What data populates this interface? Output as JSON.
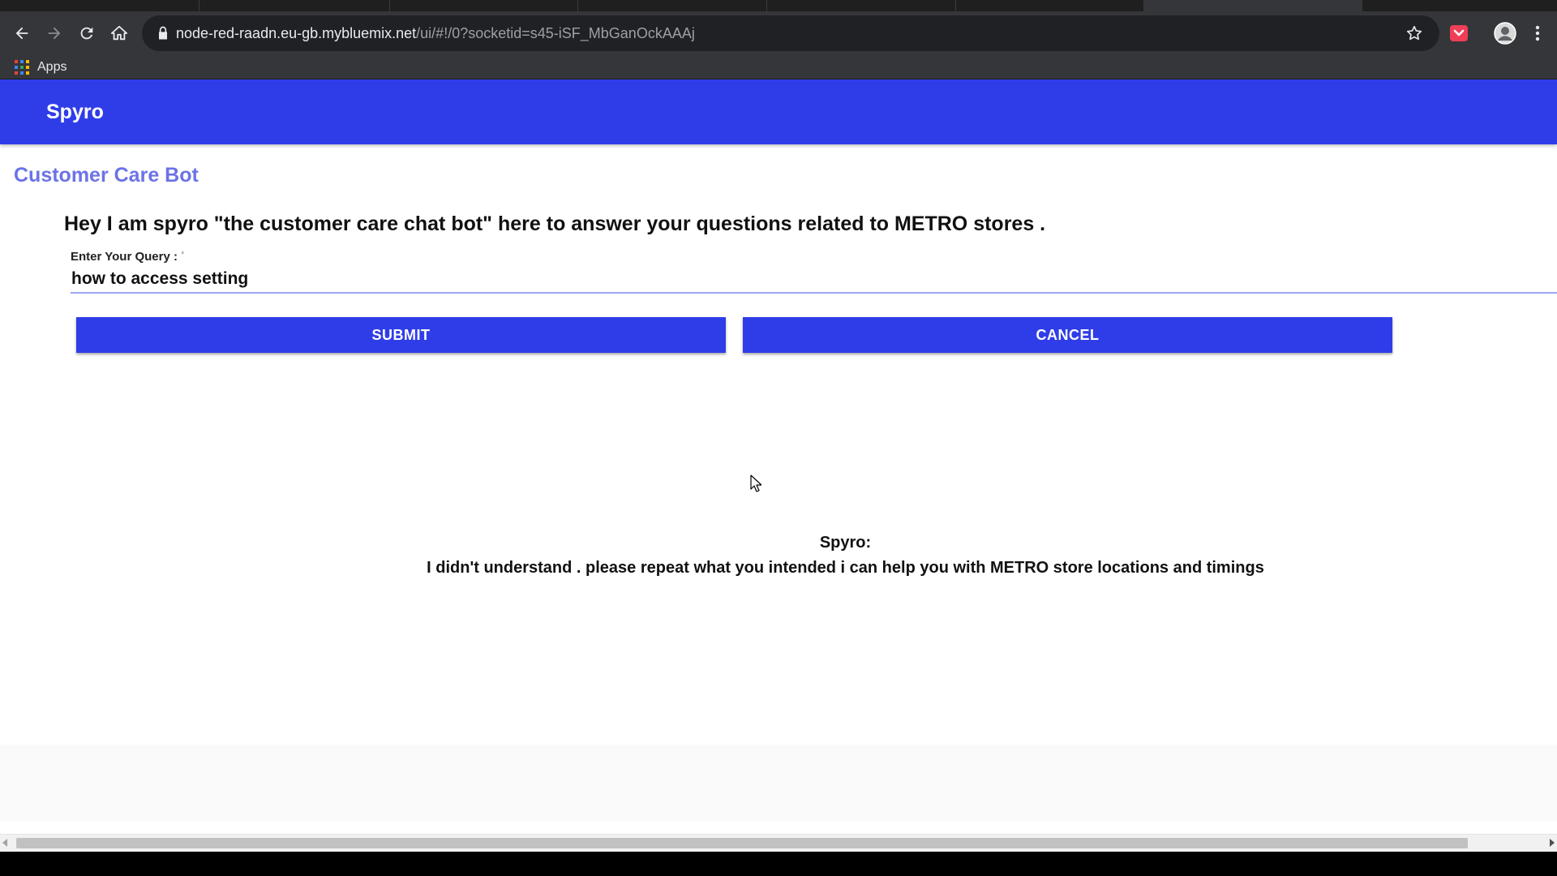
{
  "browser": {
    "url_host": "node-red-raadn.eu-gb.mybluemix.net",
    "url_path": "/ui/#!/0?socketid=s45-iSF_MbGanOckAAAj",
    "bookmarks_apps_label": "Apps"
  },
  "app": {
    "title": "Spyro",
    "accent_color": "#2f3de9"
  },
  "main": {
    "group_title": "Customer Care Bot",
    "intro_text": "Hey I am spyro \"the customer care chat bot\" here to answer your questions related to METRO stores .",
    "query_label": "Enter Your Query :",
    "query_required_mark": "*",
    "query_value": "how to access setting",
    "submit_label": "SUBMIT",
    "cancel_label": "CANCEL",
    "reply_name": "Spyro:",
    "reply_text": "I didn't understand . please repeat what you intended i can help you with METRO store locations and timings"
  }
}
